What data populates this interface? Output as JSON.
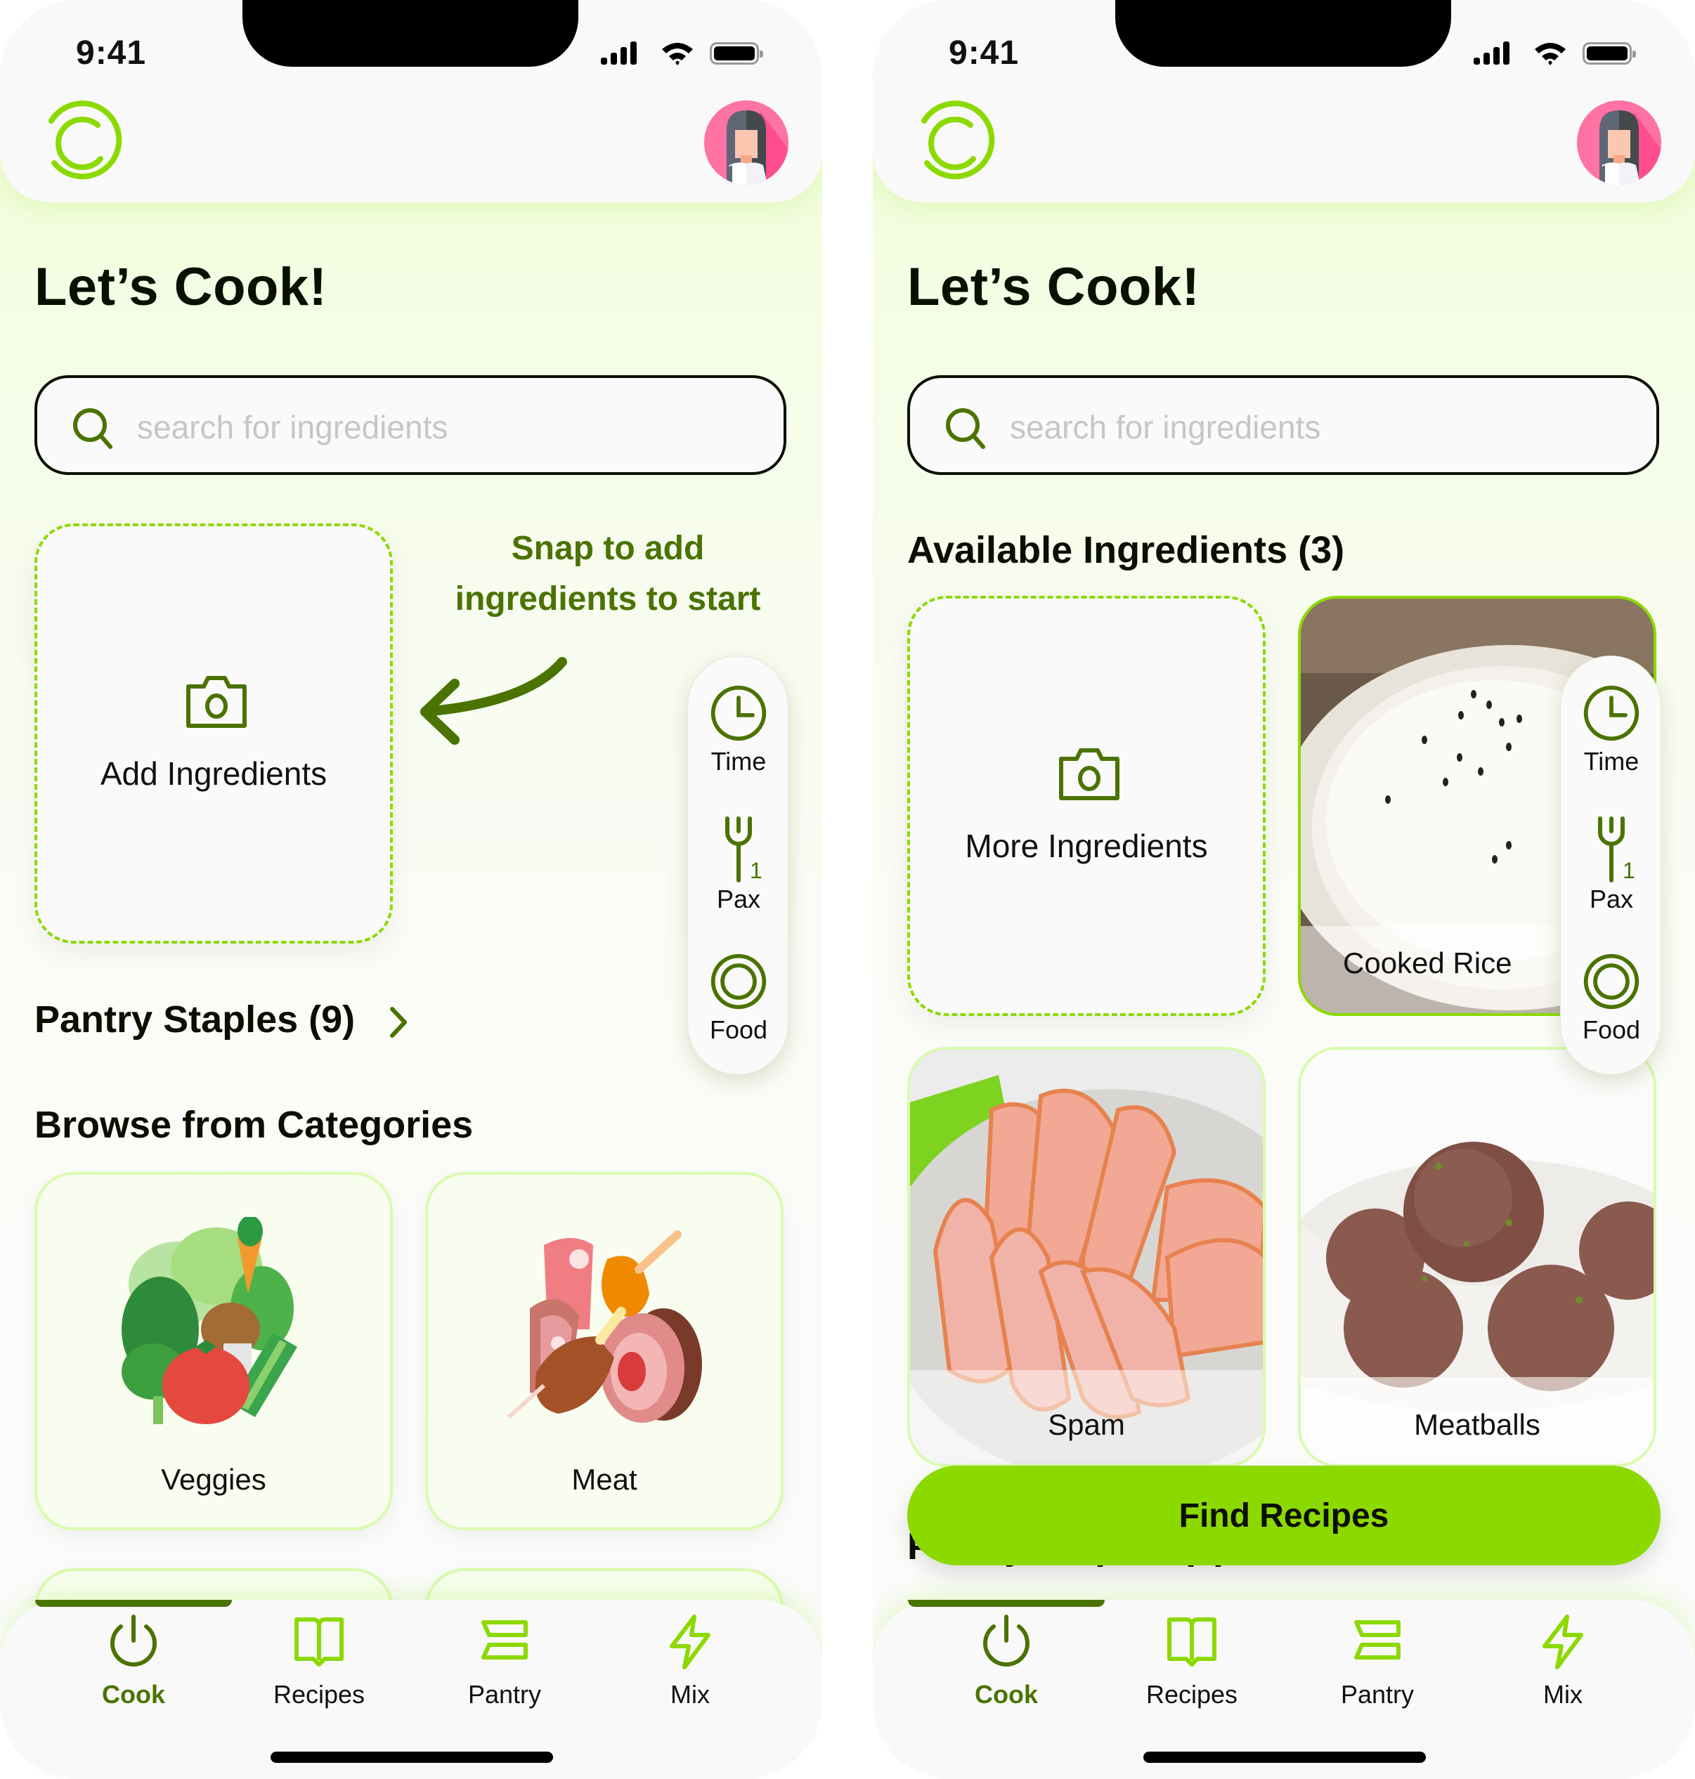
{
  "colors": {
    "brand_green": "#8cd900",
    "dark_green": "#4a7300",
    "light_green_border": "#d9fbae",
    "avatar_pink": "#ff73a4"
  },
  "screens": [
    {
      "status": {
        "time": "9:41"
      },
      "title": "Let’s Cook!",
      "search": {
        "placeholder": "search for ingredients",
        "value": ""
      },
      "add_card": {
        "label": "Add Ingredients",
        "icon": "camera-icon"
      },
      "hint": {
        "line1": "Snap to add",
        "line2": "ingredients to start"
      },
      "side_pill": {
        "items": [
          {
            "label": "Time",
            "icon": "clock-icon"
          },
          {
            "label": "Pax",
            "icon": "fork-icon",
            "value": "1"
          },
          {
            "label": "Food",
            "icon": "plate-icon"
          }
        ]
      },
      "pantry": {
        "title": "Pantry Staples (9)"
      },
      "categories": {
        "title": "Browse from Categories",
        "items": [
          {
            "label": "Veggies",
            "icon": "vegetables-icon"
          },
          {
            "label": "Meat",
            "icon": "meat-icon"
          }
        ]
      },
      "tabs": [
        {
          "label": "Cook",
          "icon": "power-icon",
          "active": true
        },
        {
          "label": "Recipes",
          "icon": "book-icon",
          "active": false
        },
        {
          "label": "Pantry",
          "icon": "shelves-icon",
          "active": false
        },
        {
          "label": "Mix",
          "icon": "lightning-icon",
          "active": false
        }
      ]
    },
    {
      "status": {
        "time": "9:41"
      },
      "title": "Let’s Cook!",
      "search": {
        "placeholder": "search for ingredients",
        "value": ""
      },
      "available": {
        "title": "Available Ingredients (3)",
        "more_label": "More Ingredients",
        "items": [
          {
            "label": "Cooked Rice",
            "selected": true
          },
          {
            "label": "Spam",
            "selected": false
          },
          {
            "label": "Meatballs",
            "selected": false
          }
        ]
      },
      "side_pill": {
        "items": [
          {
            "label": "Time",
            "icon": "clock-icon"
          },
          {
            "label": "Pax",
            "icon": "fork-icon",
            "value": "1"
          },
          {
            "label": "Food",
            "icon": "plate-icon"
          }
        ]
      },
      "find_button": "Find Recipes",
      "pantry": {
        "title": "Pantry Staples (9)"
      },
      "tabs": [
        {
          "label": "Cook",
          "icon": "power-icon",
          "active": true
        },
        {
          "label": "Recipes",
          "icon": "book-icon",
          "active": false
        },
        {
          "label": "Pantry",
          "icon": "shelves-icon",
          "active": false
        },
        {
          "label": "Mix",
          "icon": "lightning-icon",
          "active": false
        }
      ]
    }
  ]
}
